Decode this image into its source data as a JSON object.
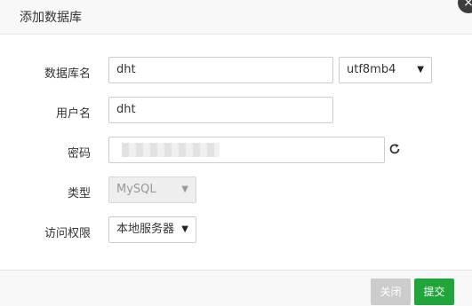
{
  "dialog": {
    "title": "添加数据库",
    "close_symbol": "×"
  },
  "form": {
    "db_name": {
      "label": "数据库名",
      "value": "dht"
    },
    "charset": {
      "value": "utf8mb4"
    },
    "username": {
      "label": "用户名",
      "value": "dht"
    },
    "password": {
      "label": "密码"
    },
    "type": {
      "label": "类型",
      "value": "MySQL",
      "disabled": true
    },
    "access": {
      "label": "访问权限",
      "value": "本地服务器"
    }
  },
  "footer": {
    "close_label": "关闭",
    "submit_label": "提交"
  },
  "colors": {
    "submit": "#20a53a",
    "close_button": "#cccccc"
  },
  "icons": {
    "refresh": "refresh-icon",
    "dropdown": "chevron-down-icon"
  }
}
